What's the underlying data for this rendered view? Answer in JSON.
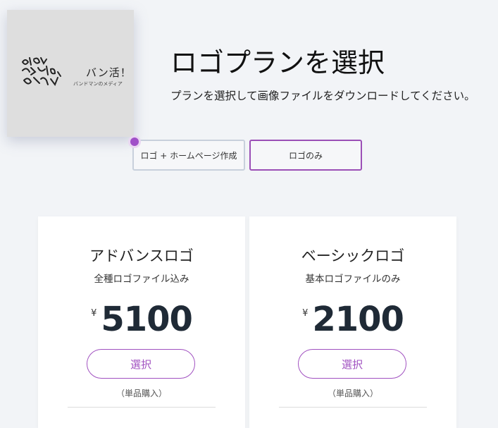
{
  "logo": {
    "name": "バン活！",
    "tagline": "バンドマンのメディア"
  },
  "header": {
    "title": "ロゴプランを選択",
    "subtitle": "プランを選択して画像ファイルをダウンロードしてください。"
  },
  "plan_tabs": [
    {
      "label": "ロゴ + ホームページ作成",
      "selected": false
    },
    {
      "label": "ロゴのみ",
      "selected": true
    }
  ],
  "plans": [
    {
      "title": "アドバンスロゴ",
      "description": "全種ロゴファイル込み",
      "currency": "¥",
      "price": "5100",
      "button": "選択",
      "note": "（単品購入）"
    },
    {
      "title": "ベーシックロゴ",
      "description": "基本ロゴファイルのみ",
      "currency": "¥",
      "price": "2100",
      "button": "選択",
      "note": "（単品購入）"
    }
  ],
  "colors": {
    "accent": "#a050c0",
    "price": "#1f2a36",
    "background": "#f2f4f7"
  }
}
